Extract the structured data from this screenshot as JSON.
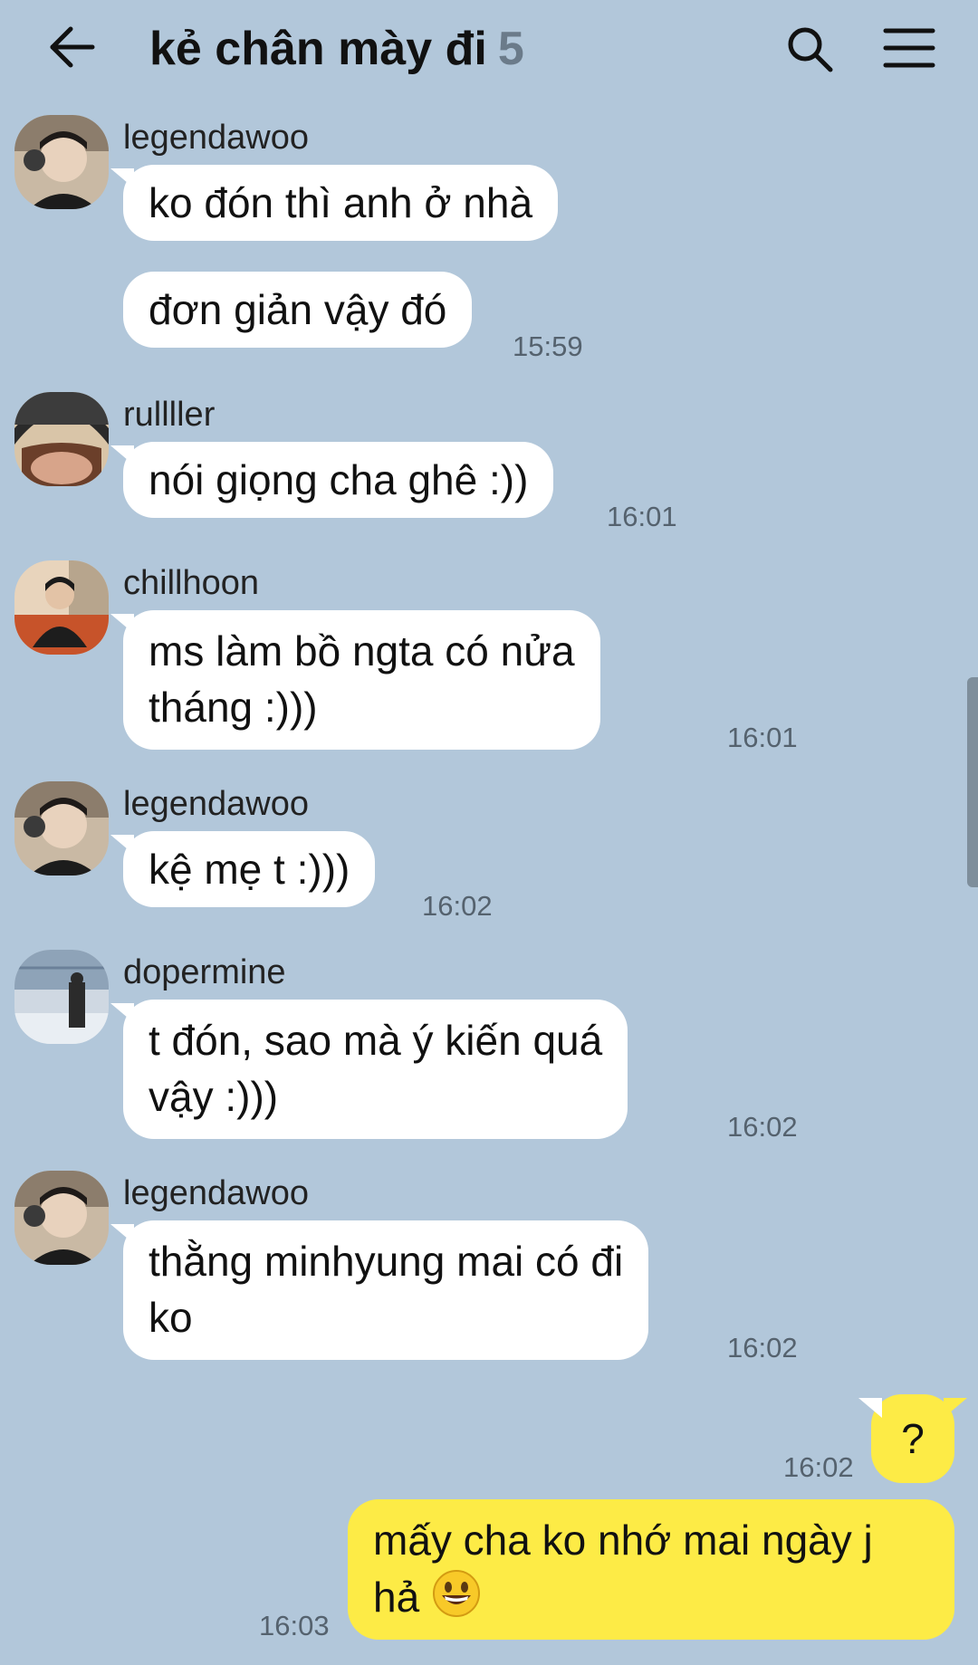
{
  "header": {
    "title": "kẻ chân mày đi",
    "member_count": "5",
    "back_icon": "arrow-left-icon",
    "search_icon": "search-icon",
    "menu_icon": "menu-icon"
  },
  "messages": [
    {
      "sender": "legendawoo",
      "avatar": "avatar-legendawoo",
      "bubbles": [
        "ko đón thì anh ở nhà",
        "đơn giản vậy đó"
      ],
      "time": "15:59"
    },
    {
      "sender": "rullller",
      "avatar": "avatar-rullller",
      "bubbles": [
        "nói giọng cha ghê :))"
      ],
      "time": "16:01"
    },
    {
      "sender": "chillhoon",
      "avatar": "avatar-chillhoon",
      "bubbles": [
        "ms làm bồ ngta có nửa",
        "tháng :)))"
      ],
      "time": "16:01"
    },
    {
      "sender": "legendawoo",
      "avatar": "avatar-legendawoo",
      "bubbles": [
        "kệ mẹ t :)))"
      ],
      "time": "16:02"
    },
    {
      "sender": "dopermine",
      "avatar": "avatar-dopermine",
      "bubbles": [
        "t đón, sao mà ý kiến quá",
        "vậy :)))"
      ],
      "time": "16:02"
    },
    {
      "sender": "legendawoo",
      "avatar": "avatar-legendawoo",
      "bubbles": [
        "thằng minhyung mai có đi",
        "ko"
      ],
      "time": "16:02"
    }
  ],
  "my_messages": [
    {
      "text": "?",
      "time": "16:02"
    },
    {
      "line1": "mấy cha ko nhớ mai ngày j",
      "line2": "hả",
      "emoji": "grinning-face-emoji",
      "time": "16:03"
    }
  ]
}
